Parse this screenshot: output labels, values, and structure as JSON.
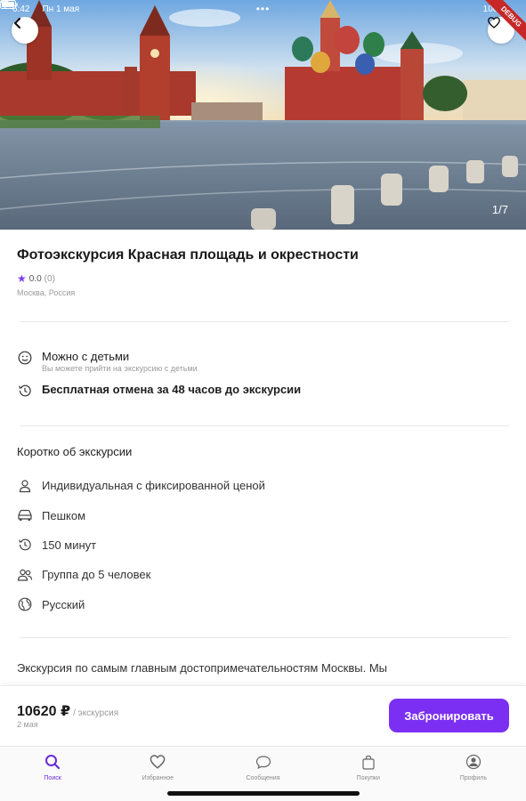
{
  "status_bar": {
    "time": "6:42",
    "date": "Пн 1 мая",
    "battery": "100 %"
  },
  "debug_banner": "DEBUG",
  "gallery": {
    "counter": "1/7"
  },
  "tour": {
    "title": "Фотоэкскурсия Красная площадь и окрестности",
    "rating": "0.0",
    "reviews": "(0)",
    "location": "Москва, Россия"
  },
  "features": [
    {
      "icon": "smile-icon",
      "label": "Можно с детьми",
      "sub": "Вы можете прийти на экскурсию с детьми"
    },
    {
      "icon": "history-icon",
      "label": "Бесплатная отмена за 48 часов до экскурсии",
      "sub": ""
    }
  ],
  "about": {
    "title": "Коротко об экскурсии",
    "items": [
      {
        "icon": "person-icon",
        "label": "Индивидуальная с фиксированной ценой"
      },
      {
        "icon": "car-icon",
        "label": "Пешком"
      },
      {
        "icon": "clock-icon",
        "label": "150 минут"
      },
      {
        "icon": "group-icon",
        "label": "Группа до 5 человек"
      },
      {
        "icon": "globe-icon",
        "label": "Русский"
      }
    ]
  },
  "description": "Экскурсия по самым главным достопримечательностям Москвы. Мы",
  "booking": {
    "price": "10620 ₽",
    "per": "/ экскурсия",
    "date": "2 мая",
    "button": "Забронировать"
  },
  "tabs": [
    {
      "icon": "search-icon",
      "label": "Поиск",
      "active": true
    },
    {
      "icon": "heart-icon",
      "label": "Избранное",
      "active": false
    },
    {
      "icon": "chat-icon",
      "label": "Сообщения",
      "active": false
    },
    {
      "icon": "bag-icon",
      "label": "Покупки",
      "active": false
    },
    {
      "icon": "profile-icon",
      "label": "Профиль",
      "active": false
    }
  ],
  "colors": {
    "accent": "#7b2ff2",
    "star": "#7b3ff2",
    "tab_active": "#6a2bd9"
  }
}
